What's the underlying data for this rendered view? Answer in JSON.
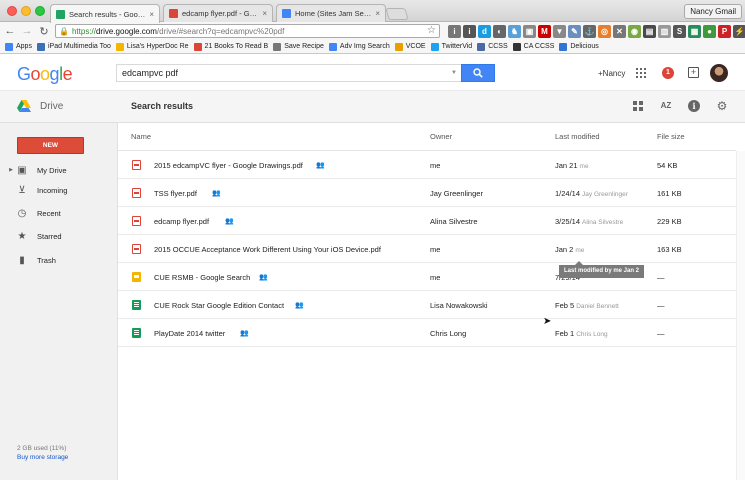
{
  "browser": {
    "tabs": [
      {
        "label": "Search results - Google Drive",
        "favicon_color": "#1fa463"
      },
      {
        "label": "edcamp flyer.pdf - Google Drive",
        "favicon_color": "#db4437"
      },
      {
        "label": "Home (Sites Jam Sessions)",
        "favicon_color": "#4285f4"
      }
    ],
    "user_button": "Nancy Gmail",
    "url_protocol": "https://",
    "url_host": "drive.google.com",
    "url_rest": "/drive/#search?q=edcampvc%20pdf",
    "bookmarks": [
      {
        "label": "Apps",
        "color": "#4285f4"
      },
      {
        "label": "iPad Multimedia Too",
        "color": "#3b6fb6"
      },
      {
        "label": "Lisa's HyperDoc Re",
        "color": "#f4b400"
      },
      {
        "label": "21 Books To Read B",
        "color": "#db4437"
      },
      {
        "label": "Save Recipe",
        "color": "#777777"
      },
      {
        "label": "Adv Img Search",
        "color": "#4285f4"
      },
      {
        "label": "VCOE",
        "color": "#e8a000"
      },
      {
        "label": "TwitterVid",
        "color": "#1da1f2"
      },
      {
        "label": "CCSS",
        "color": "#4a6aa5"
      },
      {
        "label": "CA CCSS",
        "color": "#333333"
      },
      {
        "label": "Delicious",
        "color": "#3274d1"
      }
    ]
  },
  "google_bar": {
    "logo_letters": [
      {
        "ch": "G",
        "color": "#4285f4"
      },
      {
        "ch": "o",
        "color": "#ea4335"
      },
      {
        "ch": "o",
        "color": "#fbbc05"
      },
      {
        "ch": "g",
        "color": "#4285f4"
      },
      {
        "ch": "l",
        "color": "#34a853"
      },
      {
        "ch": "e",
        "color": "#ea4335"
      }
    ],
    "search_value": "edcampvc pdf",
    "user_name": "+Nancy",
    "notification_count": "1"
  },
  "drive_header": {
    "app_name": "Drive",
    "page_title": "Search results",
    "sort_label": "AZ"
  },
  "sidebar": {
    "new_label": "NEW",
    "items": [
      {
        "label": "My Drive",
        "icon": "drive-folder-icon"
      },
      {
        "label": "Incoming",
        "icon": "incoming-icon"
      },
      {
        "label": "Recent",
        "icon": "clock-icon"
      },
      {
        "label": "Starred",
        "icon": "star-icon"
      },
      {
        "label": "Trash",
        "icon": "trash-icon"
      }
    ],
    "storage_used": "2 GB used (11%)",
    "buy_storage": "Buy more storage"
  },
  "table": {
    "columns": {
      "name": "Name",
      "owner": "Owner",
      "modified": "Last modified",
      "size": "File size"
    },
    "rows": [
      {
        "name": "2015 edcampVC flyer - Google Drawings.pdf",
        "type": "pdf",
        "owner": "me",
        "modified_date": "Jan 21",
        "modified_by": "me",
        "size": "54 KB"
      },
      {
        "name": "TSS flyer.pdf",
        "type": "pdf",
        "owner": "Jay Greenlinger",
        "modified_date": "1/24/14",
        "modified_by": "Jay Greenlinger",
        "size": "161 KB"
      },
      {
        "name": "edcamp flyer.pdf",
        "type": "pdf",
        "owner": "Alina Silvestre",
        "modified_date": "3/25/14",
        "modified_by": "Alina Silvestre",
        "size": "229 KB"
      },
      {
        "name": "2015 OCCUE Acceptance Work Different Using Your iOS Device.pdf",
        "type": "pdf",
        "owner": "me",
        "modified_date": "Jan 2",
        "modified_by": "me",
        "size": "163 KB"
      },
      {
        "name": "CUE RSMB - Google Search",
        "type": "slides",
        "owner": "me",
        "modified_date": "7/29/14",
        "modified_by": "",
        "size": "—"
      },
      {
        "name": "CUE Rock Star Google Edition Contact",
        "type": "sheet",
        "owner": "Lisa Nowakowski",
        "modified_date": "Feb 5",
        "modified_by": "Daniel Bennett",
        "size": "—"
      },
      {
        "name": "PlayDate 2014 twitter",
        "type": "sheet",
        "owner": "Chris Long",
        "modified_date": "Feb 1",
        "modified_by": "Chris Long",
        "size": "—"
      }
    ],
    "tooltip": "Last modified by me Jan 2"
  }
}
